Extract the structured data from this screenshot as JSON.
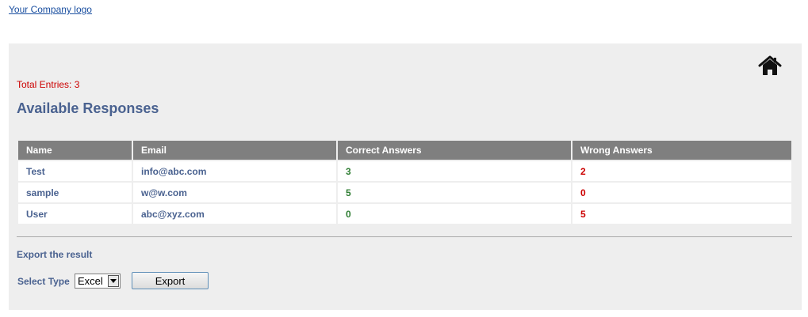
{
  "header": {
    "logo_text": "Your Company logo"
  },
  "icons": {
    "home": "home-icon",
    "dropdown": "triangle-down-icon"
  },
  "colors": {
    "panel_bg": "#eeeeee",
    "header_bg": "#7f7f7f",
    "heading": "#4a6290",
    "total": "#cc0000",
    "correct": "#2e7d32",
    "wrong": "#cc0000"
  },
  "main": {
    "total_entries": "Total Entries: 3",
    "title": "Available Responses",
    "table": {
      "columns": [
        "Name",
        "Email",
        "Correct Answers",
        "Wrong Answers"
      ],
      "rows": [
        {
          "name": "Test",
          "email": "info@abc.com",
          "correct": "3",
          "wrong": "2"
        },
        {
          "name": "sample",
          "email": "w@w.com",
          "correct": "5",
          "wrong": "0"
        },
        {
          "name": "User",
          "email": "abc@xyz.com",
          "correct": "0",
          "wrong": "5"
        }
      ]
    },
    "export": {
      "title": "Export the result",
      "select_label": "Select Type",
      "select_value": "Excel",
      "button_label": "Export"
    }
  }
}
